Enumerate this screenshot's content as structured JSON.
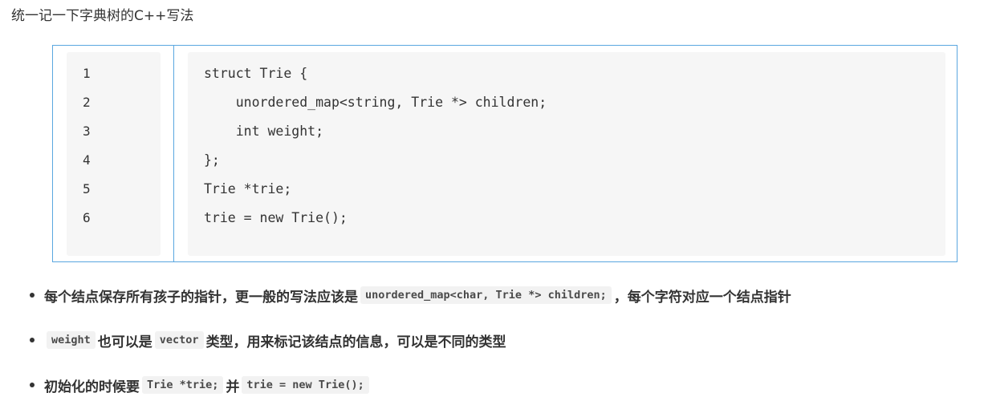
{
  "intro": {
    "text": "统一记一下字典树的C++写法"
  },
  "code_block": {
    "line_numbers": [
      "1",
      "2",
      "3",
      "4",
      "5",
      "6"
    ],
    "lines": [
      "struct Trie {",
      "    unordered_map<string, Trie *> children;",
      "    int weight;",
      "};",
      "Trie *trie;",
      "trie = new Trie();"
    ]
  },
  "bullets": [
    {
      "text_before": "每个结点保存所有孩子的指针，更一般的写法应该是",
      "code": "unordered_map<char, Trie *> children;",
      "text_after": "，每个字符对应一个结点指针"
    },
    {
      "code": "weight",
      "text_middle": "也可以是",
      "code2": "vector",
      "text_after": "类型，用来标记该结点的信息，可以是不同的类型"
    },
    {
      "text_before": "初始化的时候要",
      "code": "Trie *trie;",
      "text_middle": "并",
      "code2": "trie = new Trie();"
    }
  ]
}
